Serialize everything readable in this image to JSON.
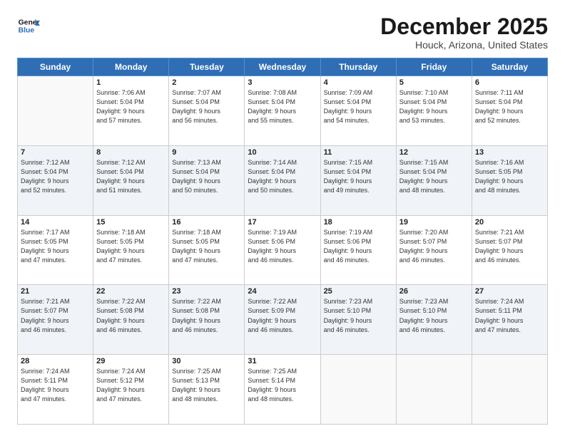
{
  "header": {
    "logo_line1": "General",
    "logo_line2": "Blue",
    "month_title": "December 2025",
    "location": "Houck, Arizona, United States"
  },
  "weekdays": [
    "Sunday",
    "Monday",
    "Tuesday",
    "Wednesday",
    "Thursday",
    "Friday",
    "Saturday"
  ],
  "weeks": [
    [
      {
        "day": "",
        "info": ""
      },
      {
        "day": "1",
        "info": "Sunrise: 7:06 AM\nSunset: 5:04 PM\nDaylight: 9 hours\nand 57 minutes."
      },
      {
        "day": "2",
        "info": "Sunrise: 7:07 AM\nSunset: 5:04 PM\nDaylight: 9 hours\nand 56 minutes."
      },
      {
        "day": "3",
        "info": "Sunrise: 7:08 AM\nSunset: 5:04 PM\nDaylight: 9 hours\nand 55 minutes."
      },
      {
        "day": "4",
        "info": "Sunrise: 7:09 AM\nSunset: 5:04 PM\nDaylight: 9 hours\nand 54 minutes."
      },
      {
        "day": "5",
        "info": "Sunrise: 7:10 AM\nSunset: 5:04 PM\nDaylight: 9 hours\nand 53 minutes."
      },
      {
        "day": "6",
        "info": "Sunrise: 7:11 AM\nSunset: 5:04 PM\nDaylight: 9 hours\nand 52 minutes."
      }
    ],
    [
      {
        "day": "7",
        "info": "Sunrise: 7:12 AM\nSunset: 5:04 PM\nDaylight: 9 hours\nand 52 minutes."
      },
      {
        "day": "8",
        "info": "Sunrise: 7:12 AM\nSunset: 5:04 PM\nDaylight: 9 hours\nand 51 minutes."
      },
      {
        "day": "9",
        "info": "Sunrise: 7:13 AM\nSunset: 5:04 PM\nDaylight: 9 hours\nand 50 minutes."
      },
      {
        "day": "10",
        "info": "Sunrise: 7:14 AM\nSunset: 5:04 PM\nDaylight: 9 hours\nand 50 minutes."
      },
      {
        "day": "11",
        "info": "Sunrise: 7:15 AM\nSunset: 5:04 PM\nDaylight: 9 hours\nand 49 minutes."
      },
      {
        "day": "12",
        "info": "Sunrise: 7:15 AM\nSunset: 5:04 PM\nDaylight: 9 hours\nand 48 minutes."
      },
      {
        "day": "13",
        "info": "Sunrise: 7:16 AM\nSunset: 5:05 PM\nDaylight: 9 hours\nand 48 minutes."
      }
    ],
    [
      {
        "day": "14",
        "info": "Sunrise: 7:17 AM\nSunset: 5:05 PM\nDaylight: 9 hours\nand 47 minutes."
      },
      {
        "day": "15",
        "info": "Sunrise: 7:18 AM\nSunset: 5:05 PM\nDaylight: 9 hours\nand 47 minutes."
      },
      {
        "day": "16",
        "info": "Sunrise: 7:18 AM\nSunset: 5:05 PM\nDaylight: 9 hours\nand 47 minutes."
      },
      {
        "day": "17",
        "info": "Sunrise: 7:19 AM\nSunset: 5:06 PM\nDaylight: 9 hours\nand 46 minutes."
      },
      {
        "day": "18",
        "info": "Sunrise: 7:19 AM\nSunset: 5:06 PM\nDaylight: 9 hours\nand 46 minutes."
      },
      {
        "day": "19",
        "info": "Sunrise: 7:20 AM\nSunset: 5:07 PM\nDaylight: 9 hours\nand 46 minutes."
      },
      {
        "day": "20",
        "info": "Sunrise: 7:21 AM\nSunset: 5:07 PM\nDaylight: 9 hours\nand 46 minutes."
      }
    ],
    [
      {
        "day": "21",
        "info": "Sunrise: 7:21 AM\nSunset: 5:07 PM\nDaylight: 9 hours\nand 46 minutes."
      },
      {
        "day": "22",
        "info": "Sunrise: 7:22 AM\nSunset: 5:08 PM\nDaylight: 9 hours\nand 46 minutes."
      },
      {
        "day": "23",
        "info": "Sunrise: 7:22 AM\nSunset: 5:08 PM\nDaylight: 9 hours\nand 46 minutes."
      },
      {
        "day": "24",
        "info": "Sunrise: 7:22 AM\nSunset: 5:09 PM\nDaylight: 9 hours\nand 46 minutes."
      },
      {
        "day": "25",
        "info": "Sunrise: 7:23 AM\nSunset: 5:10 PM\nDaylight: 9 hours\nand 46 minutes."
      },
      {
        "day": "26",
        "info": "Sunrise: 7:23 AM\nSunset: 5:10 PM\nDaylight: 9 hours\nand 46 minutes."
      },
      {
        "day": "27",
        "info": "Sunrise: 7:24 AM\nSunset: 5:11 PM\nDaylight: 9 hours\nand 47 minutes."
      }
    ],
    [
      {
        "day": "28",
        "info": "Sunrise: 7:24 AM\nSunset: 5:11 PM\nDaylight: 9 hours\nand 47 minutes."
      },
      {
        "day": "29",
        "info": "Sunrise: 7:24 AM\nSunset: 5:12 PM\nDaylight: 9 hours\nand 47 minutes."
      },
      {
        "day": "30",
        "info": "Sunrise: 7:25 AM\nSunset: 5:13 PM\nDaylight: 9 hours\nand 48 minutes."
      },
      {
        "day": "31",
        "info": "Sunrise: 7:25 AM\nSunset: 5:14 PM\nDaylight: 9 hours\nand 48 minutes."
      },
      {
        "day": "",
        "info": ""
      },
      {
        "day": "",
        "info": ""
      },
      {
        "day": "",
        "info": ""
      }
    ]
  ]
}
